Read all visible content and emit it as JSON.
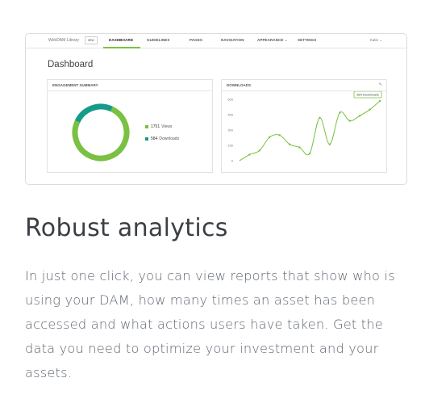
{
  "dashboard": {
    "brand": "WebDAM Library",
    "chip": "wtw",
    "nav": [
      "DASHBOARD",
      "GUIDELINES",
      "PAGES",
      "NAVIGATION",
      "APPEARANCE",
      "SETTINGS"
    ],
    "user": "Katie",
    "title": "Dashboard",
    "engagement": {
      "heading": "ENGAGEMENT SUMMARY",
      "views_count": "1751",
      "views_label": "Views",
      "downloads_count": "584",
      "downloads_label": "Downloads",
      "views_color": "#7ac142",
      "downloads_color": "#159b8a"
    },
    "downloads": {
      "heading": "DOWNLOADS",
      "callout": "584 Downloads",
      "ticks": [
        "600",
        "450",
        "300",
        "150",
        "0"
      ]
    }
  },
  "chart_data": [
    {
      "type": "pie",
      "title": "ENGAGEMENT SUMMARY",
      "categories": [
        "Views",
        "Downloads"
      ],
      "values": [
        1751,
        584
      ],
      "colors": [
        "#7ac142",
        "#159b8a"
      ]
    },
    {
      "type": "line",
      "title": "DOWNLOADS",
      "ylim": [
        0,
        600
      ],
      "y_ticks": [
        0,
        150,
        300,
        450,
        600
      ],
      "values": [
        0,
        60,
        100,
        230,
        250,
        160,
        130,
        70,
        420,
        160,
        470,
        390,
        440,
        500,
        584
      ],
      "color": "#7ac142",
      "annotation": "584 Downloads"
    }
  ],
  "section": {
    "heading": "Robust analytics",
    "body": "In just one click, you can view reports that show who is using your DAM, how many times an asset has been accessed and what actions users have taken. Get the data you need to optimize your investment and your assets."
  }
}
